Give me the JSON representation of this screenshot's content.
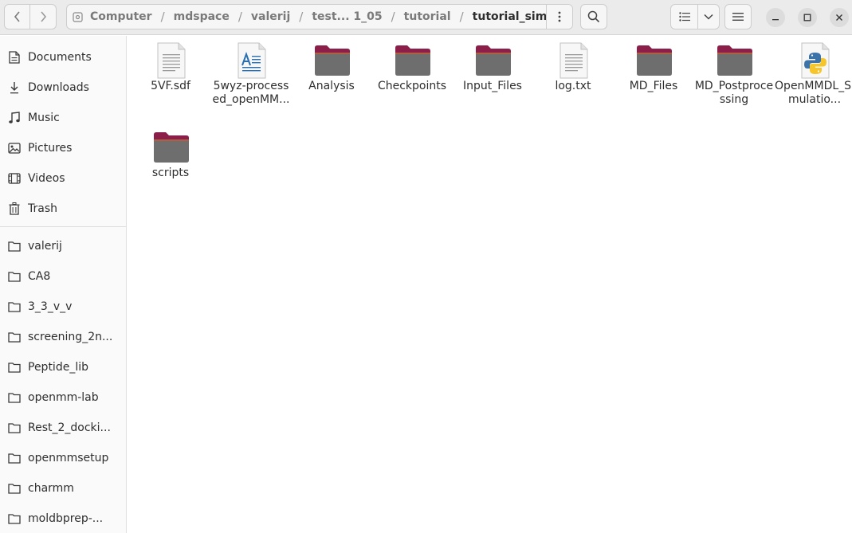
{
  "header": {
    "path": [
      {
        "label": "Computer"
      },
      {
        "label": "mdspace"
      },
      {
        "label": "valerij"
      },
      {
        "label": "test... 1_05"
      },
      {
        "label": "tutorial"
      },
      {
        "label": "tutorial_simulation"
      }
    ]
  },
  "sidebar": {
    "places": [
      {
        "label": "Documents",
        "icon": "document-icon"
      },
      {
        "label": "Downloads",
        "icon": "download-icon"
      },
      {
        "label": "Music",
        "icon": "music-icon"
      },
      {
        "label": "Pictures",
        "icon": "picture-icon"
      },
      {
        "label": "Videos",
        "icon": "video-icon"
      },
      {
        "label": "Trash",
        "icon": "trash-icon"
      }
    ],
    "bookmarks": [
      {
        "label": "valerij"
      },
      {
        "label": "CA8"
      },
      {
        "label": "3_3_v_v"
      },
      {
        "label": "screening_2n..."
      },
      {
        "label": "Peptide_lib"
      },
      {
        "label": "openmm-lab"
      },
      {
        "label": "Rest_2_docki..."
      },
      {
        "label": "openmmsetup"
      },
      {
        "label": "charmm"
      },
      {
        "label": "moldbprep-..."
      }
    ]
  },
  "files": [
    {
      "name": "5VF.sdf",
      "type": "text"
    },
    {
      "name": "5wyz-processed_openMM...",
      "type": "document"
    },
    {
      "name": "Analysis",
      "type": "folder"
    },
    {
      "name": "Checkpoints",
      "type": "folder"
    },
    {
      "name": "Input_Files",
      "type": "folder"
    },
    {
      "name": "log.txt",
      "type": "text"
    },
    {
      "name": "MD_Files",
      "type": "folder"
    },
    {
      "name": "MD_Postprocessing",
      "type": "folder"
    },
    {
      "name": "OpenMMDL_Simulatio...",
      "type": "python"
    },
    {
      "name": "scripts",
      "type": "folder"
    }
  ],
  "colors": {
    "folder_top": "#8c1f4a",
    "folder_body": "#6e6e6e",
    "accent": "#e95420"
  }
}
